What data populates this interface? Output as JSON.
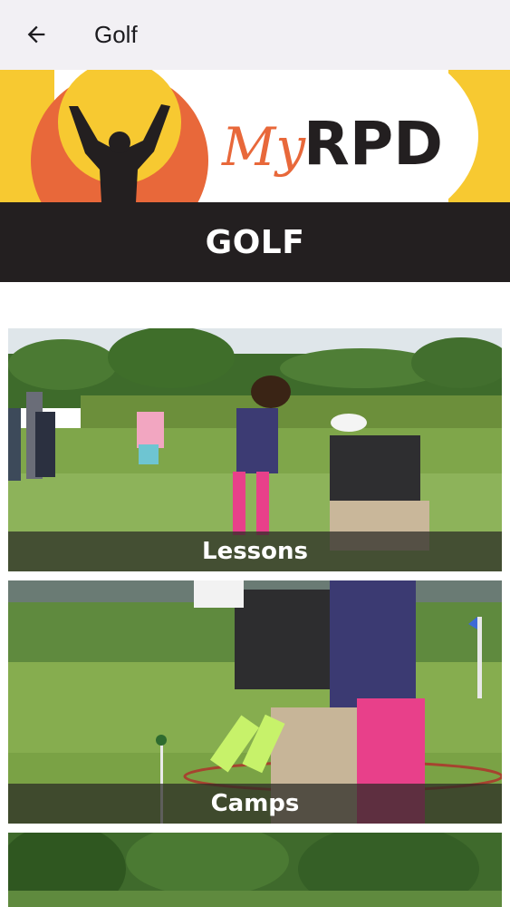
{
  "app_bar": {
    "title": "Golf",
    "back_icon": "arrow-left-icon"
  },
  "banner": {
    "logo_text": "MyRPD",
    "title": "GOLF",
    "colors": {
      "yellow": "#f7c931",
      "orange": "#e8683a",
      "dark": "#231f20"
    }
  },
  "cards": [
    {
      "label": "Lessons"
    },
    {
      "label": "Camps"
    },
    {
      "label": ""
    }
  ]
}
